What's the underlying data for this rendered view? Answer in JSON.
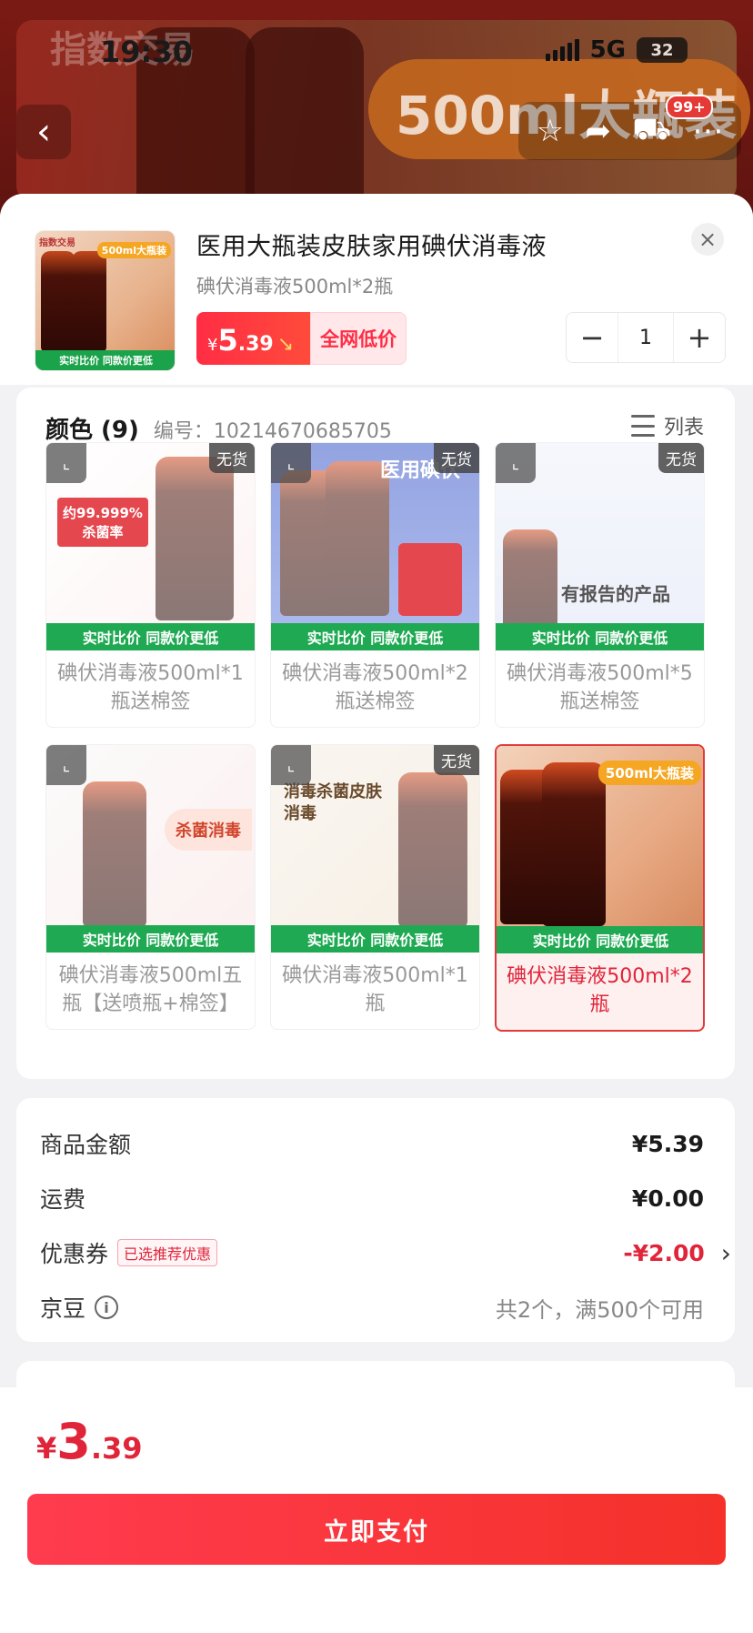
{
  "status_bar": {
    "time": "19:30",
    "network": "5G",
    "battery": "32"
  },
  "background": {
    "banner_text": "指数交易",
    "pill_text": "500ml大瓶装",
    "cart_badge": "99+"
  },
  "product": {
    "title": "医用大瓶装皮肤家用碘伏消毒液",
    "spec": "碘伏消毒液500ml*2瓶",
    "price_yen": "¥",
    "price_int": "5",
    "price_dec": ".39",
    "price_tag": "全网低价",
    "quantity": "1",
    "thumb_tag": "500ml大瓶装",
    "thumb_brand": "指数交易",
    "thumb_bar": "实时比价 同款价更低"
  },
  "variants": {
    "title": "颜色 (9)",
    "code": "编号：10214670685705",
    "list_label": "列表",
    "bar_text": "实时比价 同款价更低",
    "soldout_label": "无货",
    "items": [
      {
        "label": "碘伏消毒液500ml*1瓶送棉签",
        "overlay": "约99.999%杀菌率"
      },
      {
        "label": "碘伏消毒液500ml*2瓶送棉签",
        "overlay": "医用碘伏"
      },
      {
        "label": "碘伏消毒液500ml*5瓶送棉签",
        "overlay": "有报告的产品"
      },
      {
        "label": "碘伏消毒液500ml五瓶【送喷瓶+棉签】",
        "overlay": "杀菌消毒"
      },
      {
        "label": "碘伏消毒液500ml*1瓶",
        "overlay": "消毒杀菌皮肤消毒"
      },
      {
        "label": "碘伏消毒液500ml*2瓶",
        "overlay": "500ml大瓶装"
      }
    ]
  },
  "summary": {
    "amount_label": "商品金额",
    "amount_value": "¥5.39",
    "shipping_label": "运费",
    "shipping_value": "¥0.00",
    "coupon_label": "优惠券",
    "coupon_tag": "已选推荐优惠",
    "coupon_value": "-¥2.00",
    "beans_label": "京豆",
    "beans_note": "共2个，满500个可用"
  },
  "footer": {
    "total_yen": "¥",
    "total_int": "3",
    "total_dec": ".39",
    "pay_label": "立即支付"
  },
  "colors": {
    "accent": "#e0253a",
    "pay_gradient_start": "#ff3b4f",
    "pay_gradient_end": "#f5312a",
    "bar_green": "#1ea952"
  }
}
